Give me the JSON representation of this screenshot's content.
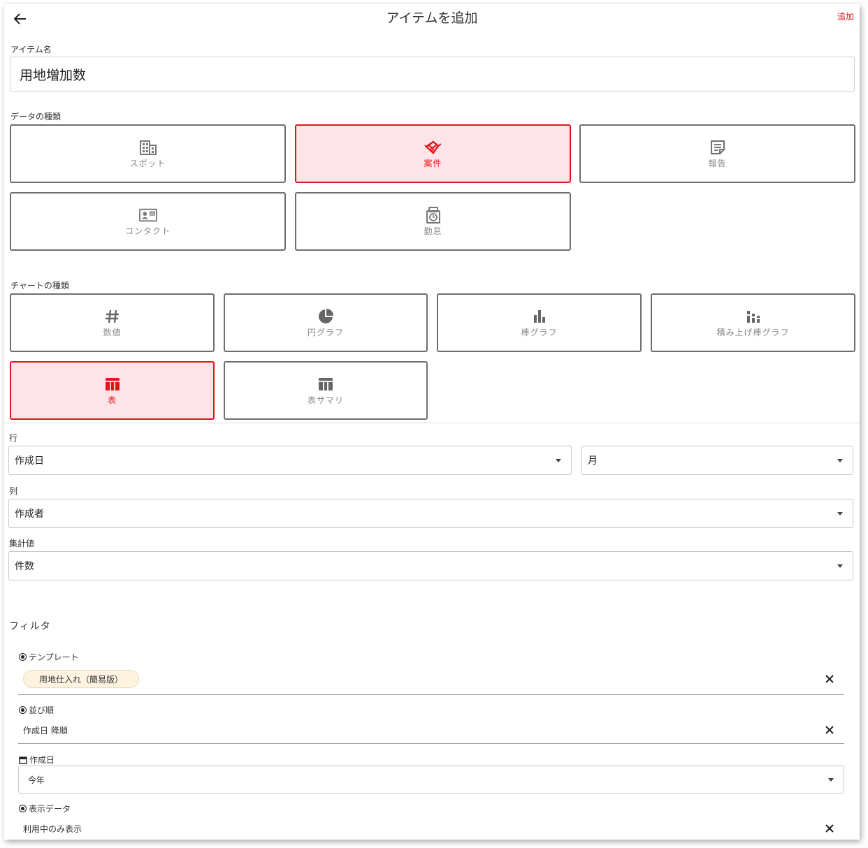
{
  "header": {
    "title": "アイテムを追加",
    "add_label": "追加"
  },
  "item_name": {
    "label": "アイテム名",
    "value": "用地増加数"
  },
  "data_type": {
    "label": "データの種類",
    "options": [
      {
        "label": "スポット",
        "icon": "building-icon",
        "selected": false
      },
      {
        "label": "案件",
        "icon": "handshake-icon",
        "selected": true
      },
      {
        "label": "報告",
        "icon": "note-icon",
        "selected": false
      },
      {
        "label": "コンタクト",
        "icon": "contact-card-icon",
        "selected": false
      },
      {
        "label": "勤怠",
        "icon": "clock-badge-icon",
        "selected": false
      }
    ]
  },
  "chart_type": {
    "label": "チャートの種類",
    "options": [
      {
        "label": "数値",
        "icon": "hash-icon",
        "selected": false
      },
      {
        "label": "円グラフ",
        "icon": "pie-chart-icon",
        "selected": false
      },
      {
        "label": "棒グラフ",
        "icon": "bar-chart-icon",
        "selected": false
      },
      {
        "label": "積み上げ棒グラフ",
        "icon": "stacked-bar-chart-icon",
        "selected": false
      },
      {
        "label": "表",
        "icon": "table-icon",
        "selected": true
      },
      {
        "label": "表サマリ",
        "icon": "table-summary-icon",
        "selected": false
      }
    ]
  },
  "rows": {
    "label": "行",
    "value": "作成日",
    "unit_value": "月"
  },
  "columns": {
    "label": "列",
    "value": "作成者"
  },
  "aggregate": {
    "label": "集計値",
    "value": "件数"
  },
  "filter": {
    "label": "フィルタ",
    "template": {
      "label": "テンプレート",
      "chip": "用地仕入れ（簡易版）"
    },
    "sort": {
      "label": "並び順",
      "value": "作成日 降順"
    },
    "created": {
      "label": "作成日",
      "value": "今年"
    },
    "display": {
      "label": "表示データ",
      "value": "利用中のみ表示"
    }
  },
  "colors": {
    "accent": "#e3151a",
    "selected_bg": "#fce4e8",
    "chip_bg": "#fdf3e0"
  }
}
